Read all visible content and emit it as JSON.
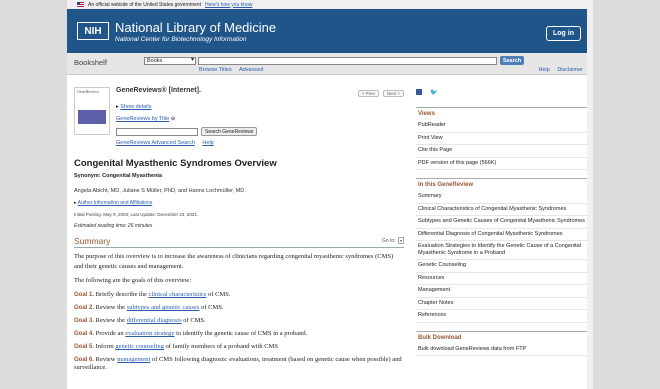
{
  "gov_banner": {
    "text": "An official website of the United States government",
    "link": "Here's how you know"
  },
  "header": {
    "logo": "NIH",
    "title": "National Library of Medicine",
    "subtitle": "National Center for Biotechnology Information",
    "login": "Log in"
  },
  "searchbar": {
    "section": "Bookshelf",
    "db_selected": "Books",
    "search_button": "Search",
    "links": [
      "Browse Titles",
      "Advanced"
    ],
    "help_links": [
      "Help",
      "Disclaimer"
    ]
  },
  "book": {
    "cover_text": "GeneReviews",
    "title": "GeneReviews® [Internet].",
    "prev": "< Prev",
    "next": "Next >",
    "show_details": "Show details",
    "by_title": "GeneReviews by Title",
    "search_button": "Search GeneReviews",
    "advanced_search": "GeneReviews Advanced Search",
    "help": "Help"
  },
  "article": {
    "title": "Congenital Myasthenic Syndromes Overview",
    "synonym": "Synonym: Congenital Myasthenia",
    "authors": "Angela Abicht, MD, Juliane S Müller, PhD, and Hanns Lochmüller, MD.",
    "affiliations": "Author Information and Affiliations",
    "posting": "Initial Posting: May 9, 2003; Last Update: December 23, 2021.",
    "reading_time": "Estimated reading time: 26 minutes",
    "summary_heading": "Summary",
    "goto": "Go to:",
    "intro": "The purpose of this overview is to increase the awareness of clinicians regarding congenital myasthenic syndromes (CMS) and their genetic causes and management.",
    "goals_intro": "The following are the goals of this overview:",
    "goals": [
      {
        "label": "Goal 1.",
        "pre": "Briefly describe the ",
        "link": "clinical characteristics",
        "post": " of CMS."
      },
      {
        "label": "Goal 2.",
        "pre": "Review the ",
        "link": "subtypes and genetic causes",
        "post": " of CMS."
      },
      {
        "label": "Goal 3.",
        "pre": "Review the ",
        "link": "differential diagnosis",
        "post": " of CMS."
      },
      {
        "label": "Goal 4.",
        "pre": "Provide an ",
        "link": "evaluation strategy",
        "post": " to identify the genetic cause of CMS in a proband."
      },
      {
        "label": "Goal 5.",
        "pre": "Inform ",
        "link": "genetic counseling",
        "post": " of family members of a proband with CMS"
      },
      {
        "label": "Goal 6.",
        "pre": "Review ",
        "link": "management",
        "post": " of CMS following diagnosis: evaluations, treatment (based on genetic cause when possible) and surveillance."
      }
    ]
  },
  "sidebar": {
    "views": {
      "heading": "Views",
      "items": [
        "PubReader",
        "Print View",
        "Cite this Page",
        "PDF version of this page (566K)"
      ]
    },
    "in_this": {
      "heading": "In this GeneReview",
      "items": [
        "Summary",
        "Clinical Characteristics of Congenital Myasthenic Syndromes",
        "Subtypes and Genetic Causes of Congenital Myasthenic Syndromes",
        "Differential Diagnosis of Congenital Myasthenic Syndromes",
        "Evaluation Strategies to Identify the Genetic Cause of a Congenital Myasthenic Syndrome in a Proband",
        "Genetic Counseling",
        "Resources",
        "Management",
        "Chapter Notes",
        "References"
      ]
    },
    "bulk": {
      "heading": "Bulk Download",
      "items": [
        "Bulk download GeneReviews data from FTP"
      ]
    }
  },
  "colors": {
    "banner": "#20558a",
    "accent": "#985735",
    "link": "#2a5db0"
  }
}
